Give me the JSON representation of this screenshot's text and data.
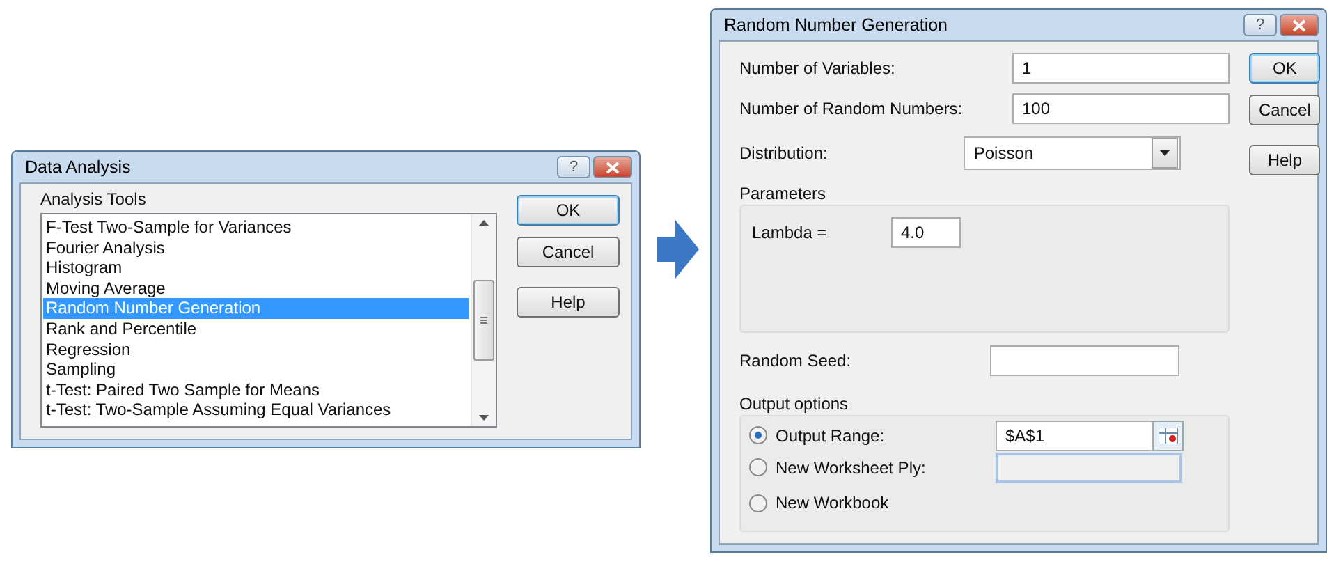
{
  "analysis_dialog": {
    "title": "Data Analysis",
    "help_glyph": "?",
    "list_label": "Analysis Tools",
    "tools": [
      {
        "label": "F-Test Two-Sample for Variances",
        "selected": false
      },
      {
        "label": "Fourier Analysis",
        "selected": false
      },
      {
        "label": "Histogram",
        "selected": false
      },
      {
        "label": "Moving Average",
        "selected": false
      },
      {
        "label": "Random Number Generation",
        "selected": true
      },
      {
        "label": "Rank and Percentile",
        "selected": false
      },
      {
        "label": "Regression",
        "selected": false
      },
      {
        "label": "Sampling",
        "selected": false
      },
      {
        "label": "t-Test: Paired Two Sample for Means",
        "selected": false
      },
      {
        "label": "t-Test: Two-Sample Assuming Equal Variances",
        "selected": false
      }
    ],
    "buttons": [
      "OK",
      "Cancel",
      "Help"
    ]
  },
  "rng_dialog": {
    "title": "Random Number Generation",
    "help_glyph": "?",
    "fields": [
      {
        "label": "Number of Variables:",
        "value": "1"
      },
      {
        "label": "Number of Random Numbers:",
        "value": "100"
      }
    ],
    "distribution": {
      "label": "Distribution:",
      "value": "Poisson"
    },
    "buttons": [
      "OK",
      "Cancel",
      "Help"
    ],
    "parameters": {
      "title": "Parameters",
      "label": "Lambda =",
      "value": "4.0"
    },
    "random_seed": {
      "label": "Random Seed:"
    },
    "output_options": {
      "title": "Output options",
      "options": [
        {
          "label": "Output Range:",
          "selected": true,
          "value": "$A$1"
        },
        {
          "label": "New Worksheet Ply:",
          "selected": false
        },
        {
          "label": "New Workbook",
          "selected": false
        }
      ]
    }
  }
}
